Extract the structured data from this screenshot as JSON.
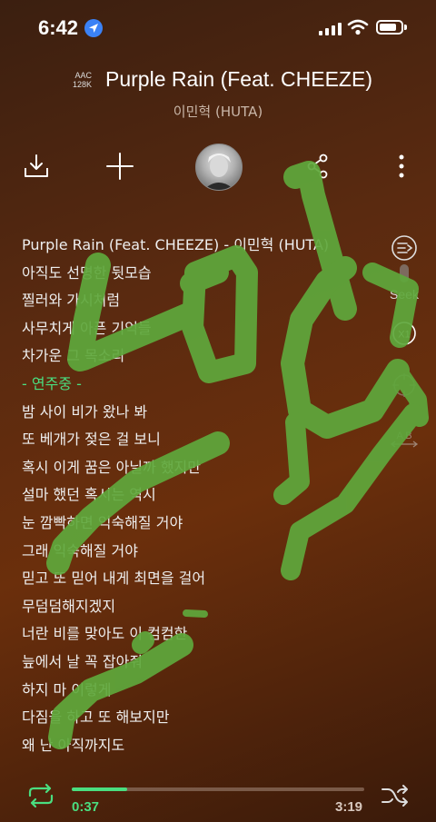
{
  "status": {
    "time": "6:42"
  },
  "header": {
    "codec": "AAC",
    "bitrate": "128K",
    "title": "Purple Rain (Feat. CHEEZE)",
    "artist": "이민혁 (HUTA)"
  },
  "toolbar": {
    "download_icon": "download-icon",
    "add_icon": "plus-icon",
    "avatar": "artist-avatar",
    "share_icon": "share-icon",
    "more_icon": "more-vertical-icon"
  },
  "lyrics": [
    "Purple Rain (Feat. CHEEZE) - 이민혁 (HUTA)",
    "아직도 선명한 뒷모습",
    "찔러와 가시처럼",
    "사무치게 아픈 기억들",
    "차가운 그 목소리",
    "- 연주중 -",
    "밤 사이 비가 왔나 봐",
    "또 베개가 젖은 걸 보니",
    "혹시 이게 꿈은 아닐까 했지만",
    "설마 했던 혹시는 역시",
    "눈 깜빡하면 익숙해질 거야",
    "그래 익숙해질 거야",
    "믿고 또 믿어 내게 최면을 걸어",
    "무덤덤해지겠지",
    "너란 비를 맞아도 이 컴컴한",
    "늪에서 날 꼭 잡아줘",
    "하지 마 이렇게",
    "다짐을 하고 또 해보지만",
    "왜 난 아직까지도"
  ],
  "active_lyric_index": 5,
  "side_controls": {
    "seek_label": "Seek",
    "speed_label": "X1",
    "ab_label": "A B"
  },
  "player": {
    "current_time": "0:37",
    "total_time": "3:19",
    "progress": 0.19,
    "repeat_icon": "repeat-icon",
    "shuffle_icon": "shuffle-icon"
  },
  "colors": {
    "accent": "#4ade80",
    "overlay_stroke": "#5fa83c"
  }
}
